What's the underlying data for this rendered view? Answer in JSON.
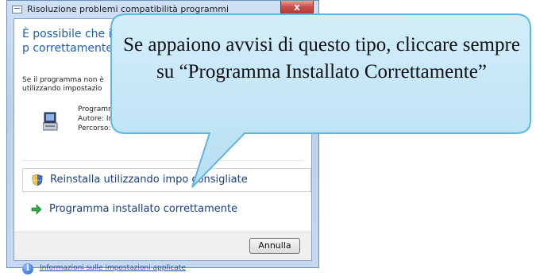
{
  "window": {
    "title": "Risoluzione problemi compatibilità programmi",
    "close_label": "x"
  },
  "dialog": {
    "heading": "È possibile che il p correttamente",
    "body_text": "Se il programma non è utilizzando impostazio",
    "program_info": {
      "name": "Programm",
      "author": "Autore: Ins",
      "path": "Percorso: Dr"
    },
    "options": [
      {
        "label": "Reinstalla utilizzando impo        consigliate",
        "icon": "shield-icon"
      },
      {
        "label": "Programma installato correttamente",
        "icon": "green-arrow-icon"
      }
    ],
    "cancel_label": "Annulla",
    "info_link": "Informazioni sulle impostazioni applicate"
  },
  "callout": {
    "text": "Se appaiono avvisi di questo tipo, cliccare sempre su “Programma Installato Correttamente”"
  },
  "colors": {
    "callout_fill": "#c4e6f6",
    "callout_border": "#5fb7dc",
    "heading": "#1f5fa8",
    "link": "#1f4ea8"
  }
}
